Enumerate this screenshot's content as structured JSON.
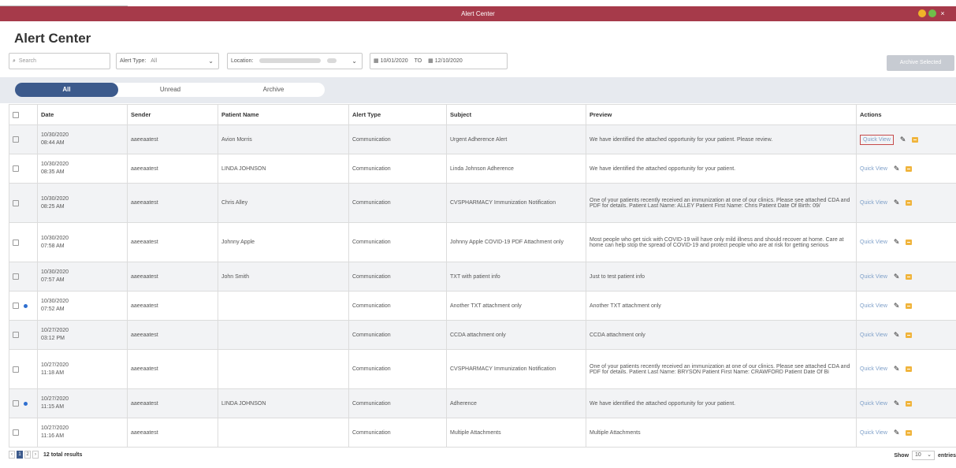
{
  "window": {
    "title": "Alert Center"
  },
  "page": {
    "title": "Alert Center"
  },
  "filters": {
    "search_placeholder": "Search",
    "alert_type_label": "Alert Type:",
    "alert_type_value": "All",
    "location_label": "Location:",
    "date_from": "10/01/2020",
    "date_to_label": "TO",
    "date_to": "12/10/2020"
  },
  "archive_selected_label": "Archive Selected",
  "tabs": [
    {
      "label": "All"
    },
    {
      "label": "Unread"
    },
    {
      "label": "Archive"
    }
  ],
  "table": {
    "headers": [
      "Date",
      "Sender",
      "Patient Name",
      "Alert Type",
      "Subject",
      "Preview",
      "Actions"
    ],
    "quick_view_label": "Quick View",
    "rows": [
      {
        "date": "10/30/2020",
        "time": "08:44 AM",
        "sender": "aaeeaatest",
        "patient": "Avion Morris",
        "type": "Communication",
        "subject": "Urgent Adherence Alert",
        "preview": "We have identified the attached opportunity for your patient. Please review.",
        "unread": false
      },
      {
        "date": "10/30/2020",
        "time": "08:35 AM",
        "sender": "aaeeaatest",
        "patient": "LINDA JOHNSON",
        "type": "Communication",
        "subject": "Linda Johnson Adherence",
        "preview": "We have identified the attached opportunity for your patient.",
        "unread": false
      },
      {
        "date": "10/30/2020",
        "time": "08:25 AM",
        "sender": "aaeeaatest",
        "patient": "Chris Alley",
        "type": "Communication",
        "subject": "CVSPHARMACY Immunization Notification",
        "preview": "One of your patients recently received an immunization at one of our clinics. Please see attached CDA and PDF for details. Patient Last Name: ALLEY Patient First Name: Chris Patient Date Of Birth: 09/",
        "unread": false
      },
      {
        "date": "10/30/2020",
        "time": "07:58 AM",
        "sender": "aaeeaatest",
        "patient": "Johnny Apple",
        "type": "Communication",
        "subject": "Johnny Apple COVID-19 PDF Attachment only",
        "preview": "Most people who get sick with COVID-19 will have only mild illness and should recover at home. Care at home can help stop the spread of COVID-19 and protect people who are at risk for getting serious",
        "unread": false
      },
      {
        "date": "10/30/2020",
        "time": "07:57 AM",
        "sender": "aaeeaatest",
        "patient": "John Smith",
        "type": "Communication",
        "subject": "TXT with patient info",
        "preview": "Just to test patient info",
        "unread": false
      },
      {
        "date": "10/30/2020",
        "time": "07:52 AM",
        "sender": "aaeeaatest",
        "patient": "",
        "type": "Communication",
        "subject": "Another TXT attachment only",
        "preview": "Another TXT attachment only",
        "unread": true
      },
      {
        "date": "10/27/2020",
        "time": "03:12 PM",
        "sender": "aaeeaatest",
        "patient": "",
        "type": "Communication",
        "subject": "CCDA attachment only",
        "preview": "CCDA attachment only",
        "unread": false
      },
      {
        "date": "10/27/2020",
        "time": "11:18 AM",
        "sender": "aaeeaatest",
        "patient": "",
        "type": "Communication",
        "subject": "CVSPHARMACY Immunization Notification",
        "preview": "One of your patients recently received an immunization at one of our clinics. Please see attached CDA and PDF for details. Patient Last Name: BRYSON Patient First Name: CRAWFORD Patient Date Of Bi",
        "unread": false
      },
      {
        "date": "10/27/2020",
        "time": "11:15 AM",
        "sender": "aaeeaatest",
        "patient": "LINDA JOHNSON",
        "type": "Communication",
        "subject": "Adherence",
        "preview": "We have identified the attached opportunity for your patient.",
        "unread": true
      },
      {
        "date": "10/27/2020",
        "time": "11:16 AM",
        "sender": "aaeeaatest",
        "patient": "",
        "type": "Communication",
        "subject": "Multiple Attachments",
        "preview": "Multiple Attachments",
        "unread": false
      }
    ]
  },
  "pagination": {
    "pages": [
      "1",
      "2"
    ],
    "prev": "‹",
    "next": "›",
    "total_results": "12 total results"
  },
  "page_size": {
    "show_label": "Show",
    "value": "10",
    "entries_label": "entries"
  },
  "colors": {
    "titlebar": "#a63a4a",
    "tab_active": "#3c5a8c",
    "link": "#7fa0c9",
    "unread_dot": "#2f6fd0",
    "archive_icon": "#f0b43c"
  }
}
